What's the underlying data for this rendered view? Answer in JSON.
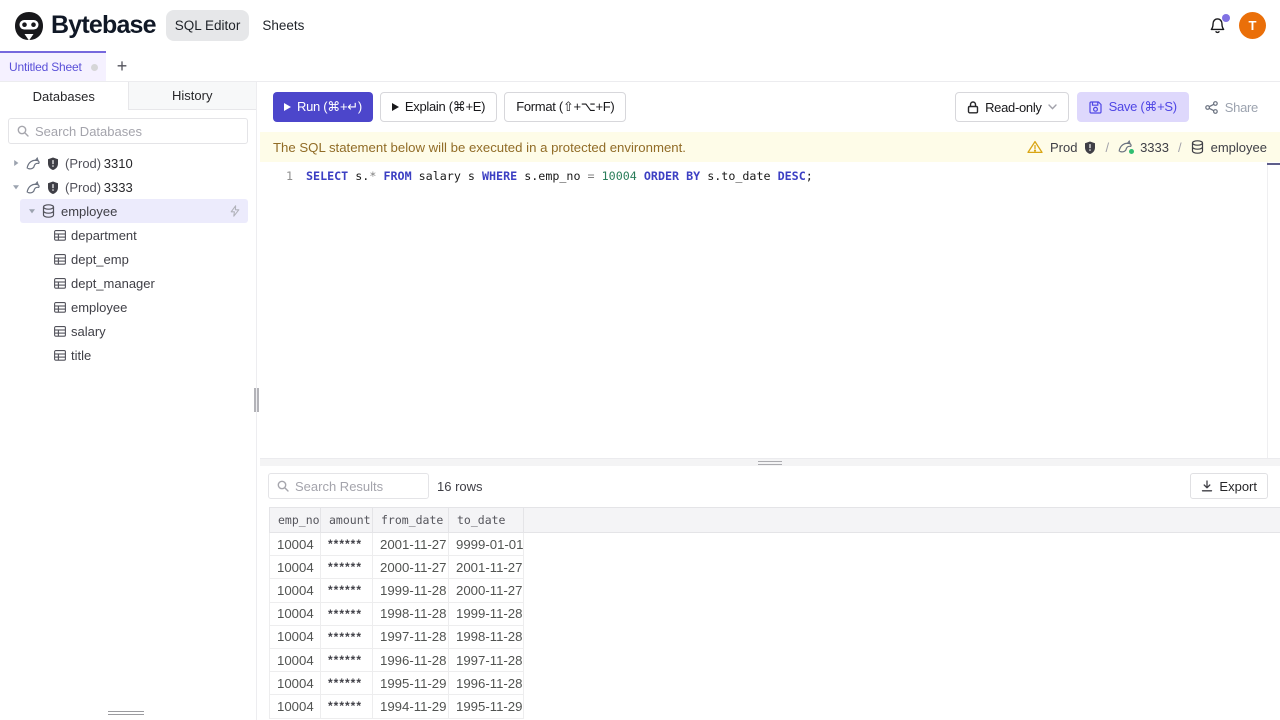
{
  "colors": {
    "accent": "#4c46cb",
    "accent_light_bg": "#ded8fc",
    "tab_active_bg": "#f5f1ff",
    "tab_indicator": "#7668dd",
    "tree_selection_bg": "#ecebfc",
    "banner_bg": "#fefce8",
    "banner_text": "#916c27",
    "avatar_bg": "#ea6f09",
    "table_header_bg": "#f4f4f6"
  },
  "topbar": {
    "brand": "Bytebase",
    "nav": [
      {
        "label": "SQL Editor",
        "active": true
      },
      {
        "label": "Sheets",
        "active": false
      }
    ],
    "avatar_initial": "T"
  },
  "tabstrip": {
    "active_tab": "Untitled Sheet",
    "add_label": "+"
  },
  "sidebar": {
    "tabs": [
      {
        "label": "Databases",
        "active": true
      },
      {
        "label": "History",
        "active": false
      }
    ],
    "search_placeholder": "Search Databases",
    "tree": [
      {
        "kind": "instance",
        "env": "(Prod)",
        "name": "3310",
        "expanded": false
      },
      {
        "kind": "instance",
        "env": "(Prod)",
        "name": "3333",
        "expanded": true
      },
      {
        "kind": "database",
        "name": "employee",
        "selected": true,
        "expanded": true
      },
      {
        "kind": "table",
        "name": "department"
      },
      {
        "kind": "table",
        "name": "dept_emp"
      },
      {
        "kind": "table",
        "name": "dept_manager"
      },
      {
        "kind": "table",
        "name": "employee"
      },
      {
        "kind": "table",
        "name": "salary"
      },
      {
        "kind": "table",
        "name": "title"
      }
    ]
  },
  "toolbar": {
    "run_label": "Run (⌘+↵)",
    "explain_label": "Explain (⌘+E)",
    "format_label": "Format (⇧+⌥+F)",
    "readonly_label": "Read-only",
    "save_label": "Save (⌘+S)",
    "share_label": "Share"
  },
  "banner": {
    "message": "The SQL statement below will be executed in a protected environment.",
    "environment": "Prod",
    "instance": "3333",
    "database": "employee",
    "separator": "/"
  },
  "editor": {
    "line_number": "1",
    "tokens": [
      {
        "text": "SELECT",
        "type": "kw"
      },
      {
        "text": " s.",
        "type": "pl"
      },
      {
        "text": "*",
        "type": "op"
      },
      {
        "text": " ",
        "type": "pl"
      },
      {
        "text": "FROM",
        "type": "kw"
      },
      {
        "text": " salary s ",
        "type": "pl"
      },
      {
        "text": "WHERE",
        "type": "kw"
      },
      {
        "text": " s.emp_no ",
        "type": "pl"
      },
      {
        "text": "=",
        "type": "op"
      },
      {
        "text": " ",
        "type": "pl"
      },
      {
        "text": "10004",
        "type": "num"
      },
      {
        "text": " ",
        "type": "pl"
      },
      {
        "text": "ORDER BY",
        "type": "kw"
      },
      {
        "text": " s.to_date ",
        "type": "pl"
      },
      {
        "text": "DESC",
        "type": "kw"
      },
      {
        "text": ";",
        "type": "pl"
      }
    ]
  },
  "results": {
    "search_placeholder": "Search Results",
    "row_count": "16 rows",
    "export_label": "Export",
    "table": {
      "columns": [
        "emp_no",
        "amount",
        "from_date",
        "to_date"
      ],
      "rows": [
        [
          "10004",
          "******",
          "2001-11-27",
          "9999-01-01"
        ],
        [
          "10004",
          "******",
          "2000-11-27",
          "2001-11-27"
        ],
        [
          "10004",
          "******",
          "1999-11-28",
          "2000-11-27"
        ],
        [
          "10004",
          "******",
          "1998-11-28",
          "1999-11-28"
        ],
        [
          "10004",
          "******",
          "1997-11-28",
          "1998-11-28"
        ],
        [
          "10004",
          "******",
          "1996-11-28",
          "1997-11-28"
        ],
        [
          "10004",
          "******",
          "1995-11-29",
          "1996-11-28"
        ],
        [
          "10004",
          "******",
          "1994-11-29",
          "1995-11-29"
        ]
      ]
    }
  }
}
